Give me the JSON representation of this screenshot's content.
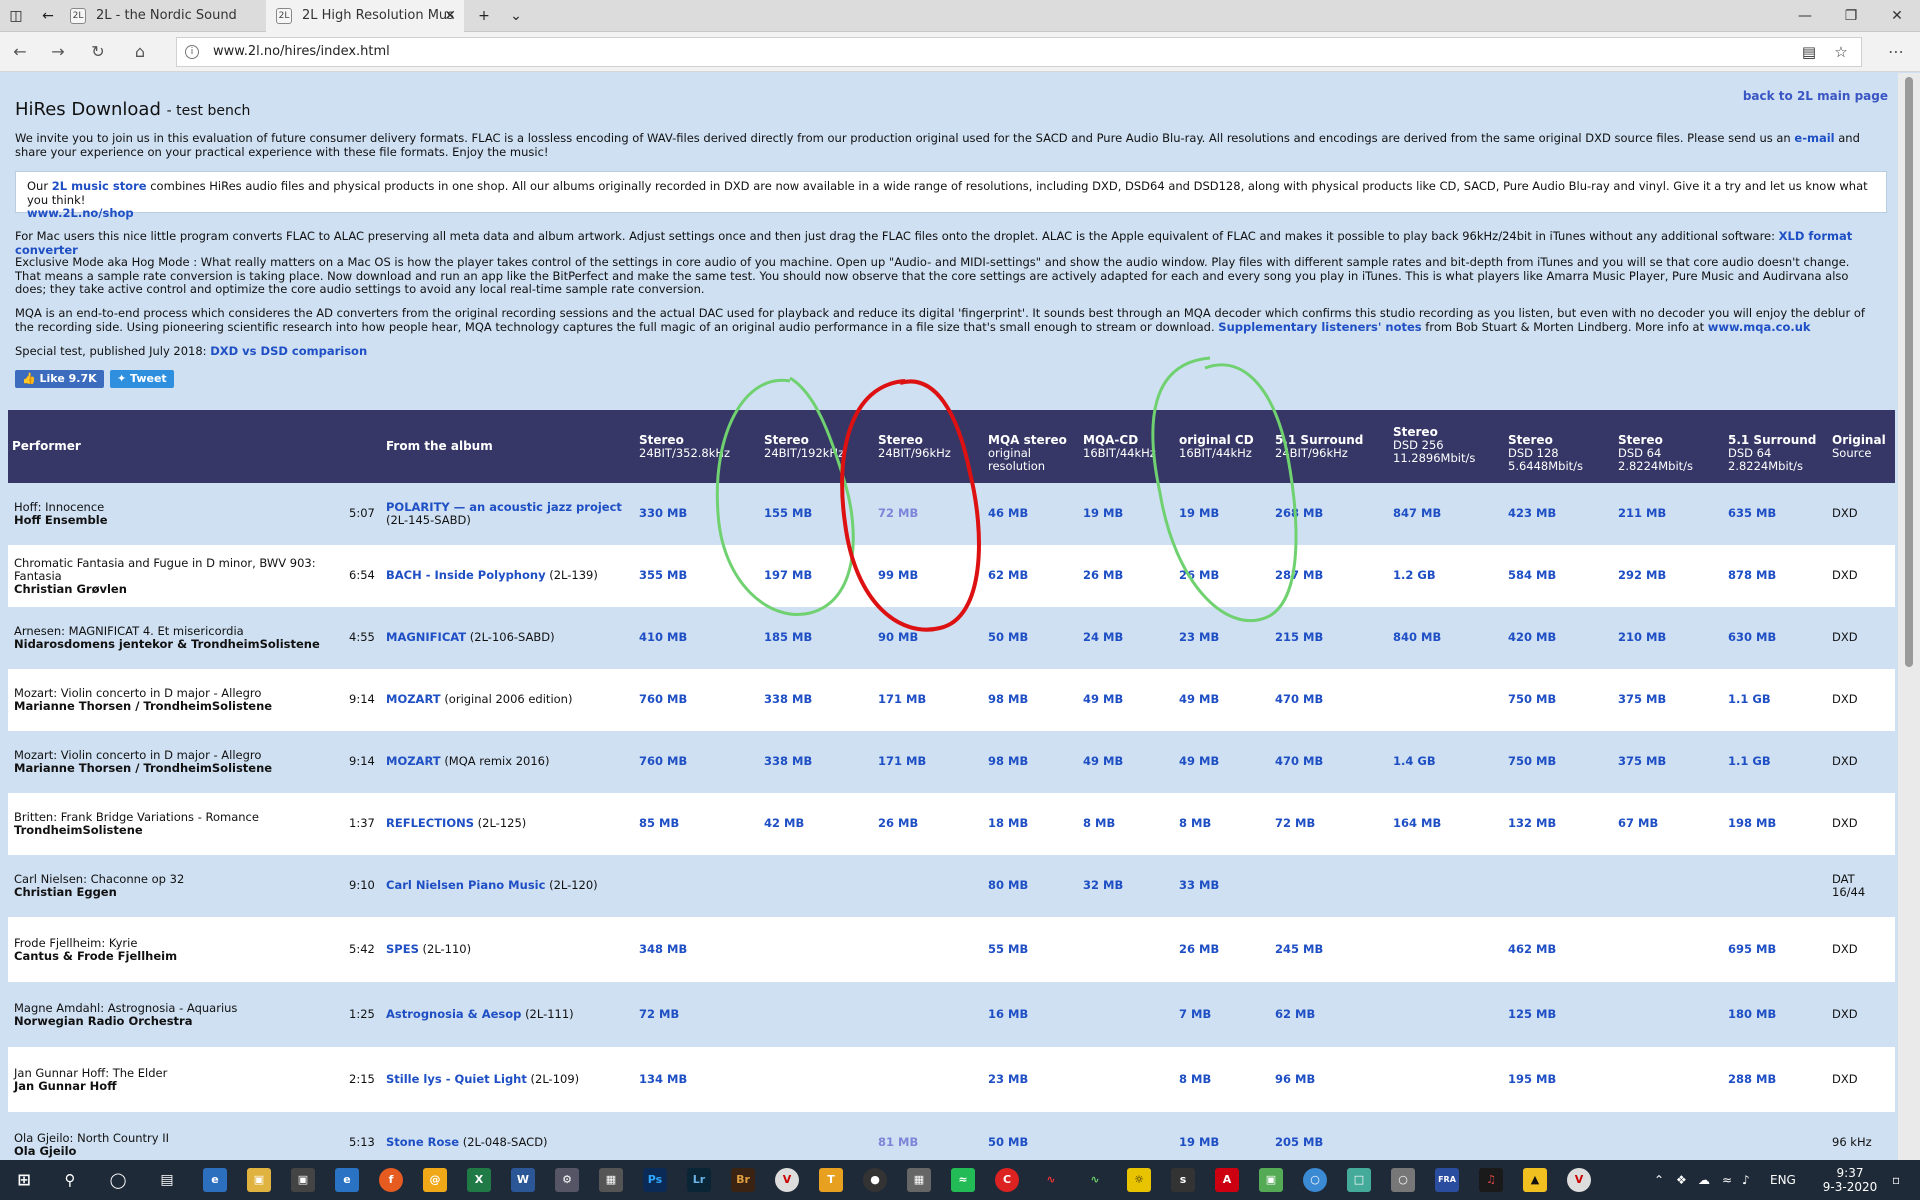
{
  "browser": {
    "tabs": [
      {
        "title": "2L - the Nordic Sound",
        "active": false
      },
      {
        "title": "2L High Resolution Mus",
        "active": true
      }
    ],
    "url": "www.2l.no/hires/index.html"
  },
  "page": {
    "top_link": "back to 2L main page",
    "title": "HiRes Download",
    "subtitle": "- test bench",
    "intro_1": "We invite you to join us in this evaluation of future consumer delivery formats. FLAC is a lossless encoding of WAV-files derived directly from our production original used for the SACD and Pure Audio Blu-ray. All resolutions and encodings are derived from the same original DXD source files. Please send us an",
    "intro_link": "e-mail",
    "intro_2": "and share your experience on your practical experience with these file formats. Enjoy the music!",
    "store_1": "Our",
    "store_link": "2L music store",
    "store_2": "combines HiRes audio files and physical products in one shop. All our albums originally recorded in DXD are now available in a wide range of resolutions, including DXD, DSD64 and DSD128, along with physical products like CD, SACD, Pure Audio Blu-ray and vinyl. Give it a try and let us know what you think!",
    "store_url": "www.2L.no/shop",
    "mac_1": "For Mac users this nice little program converts FLAC to ALAC preserving all meta data and album artwork. Adjust settings once and then just drag the FLAC files onto the droplet. ALAC is the Apple equivalent of FLAC and makes it possible to play back 96kHz/24bit in iTunes without any additional software:",
    "mac_link": "XLD format converter",
    "hog": "Exclusive Mode aka Hog Mode : What really matters on a Mac OS is how the player takes control of the settings in core audio of you machine. Open up \"Audio- and MIDI-settings\" and show the audio window. Play files with different sample rates and bit-depth from iTunes and you will se that core audio doesn't change. That means a sample rate conversion is taking place. Now download and run an app like the BitPerfect and make the same test. You should now observe that the core settings are actively adapted for each and every song you play in iTunes. This is what players like Amarra Music Player, Pure Music and Audirvana also does; they take active control and optimize the core audio settings to avoid any local real-time sample rate conversion.",
    "mqa_1": "MQA is an end-to-end process which consideres the AD converters from the original recording sessions and the actual DAC used for playback and reduce its digital 'fingerprint'. It sounds best through an MQA decoder which confirms this studio recording as you listen, but even with no decoder you will enjoy the deblur of the recording side. Using pioneering scientific research into how people hear, MQA technology captures the full magic of an original audio performance in a file size that's small enough to stream or download.",
    "mqa_link": "Supplementary listeners' notes",
    "mqa_2": "from Bob Stuart & Morten Lindberg. More info at",
    "mqa_link2": "www.mqa.co.uk",
    "special_1": "Special test, published July 2018:",
    "special_link": "DXD vs DSD comparison",
    "like_btn": "Like 9.7K",
    "tweet_btn": "Tweet"
  },
  "table": {
    "headers": [
      {
        "t": "Performer",
        "s": ""
      },
      {
        "t": "From the album",
        "s": ""
      },
      {
        "t": "Stereo",
        "s": "24BIT/352.8kHz"
      },
      {
        "t": "Stereo",
        "s": "24BIT/192kHz"
      },
      {
        "t": "Stereo",
        "s": "24BIT/96kHz"
      },
      {
        "t": "MQA stereo",
        "s": "original resolution"
      },
      {
        "t": "MQA-CD",
        "s": "16BIT/44kHz"
      },
      {
        "t": "original CD",
        "s": "16BIT/44kHz"
      },
      {
        "t": "5.1 Surround",
        "s": "24BIT/96kHz"
      },
      {
        "t": "Stereo",
        "s": "DSD 256 11.2896Mbit/s"
      },
      {
        "t": "Stereo",
        "s": "DSD 128 5.6448Mbit/s"
      },
      {
        "t": "Stereo",
        "s": "DSD 64 2.8224Mbit/s"
      },
      {
        "t": "5.1 Surround",
        "s": "DSD 64 2.8224Mbit/s"
      },
      {
        "t": "Original",
        "s": "Source"
      }
    ],
    "rows": [
      {
        "work": "Hoff: Innocence",
        "artist": "Hoff Ensemble",
        "time": "5:07",
        "album": "POLARITY — an acoustic jazz project",
        "code": "(2L-145-SABD)",
        "v": [
          "330 MB",
          "155 MB",
          "72 MB",
          "46 MB",
          "19 MB",
          "19 MB",
          "268 MB",
          "847 MB",
          "423 MB",
          "211 MB",
          "635 MB"
        ],
        "src": "DXD"
      },
      {
        "work": "Chromatic Fantasia and Fugue in D minor, BWV 903: Fantasia",
        "artist": "Christian Grøvlen",
        "time": "6:54",
        "album": "BACH - Inside Polyphony",
        "code": "(2L-139)",
        "v": [
          "355 MB",
          "197 MB",
          "99 MB",
          "62 MB",
          "26 MB",
          "26 MB",
          "287 MB",
          "1.2 GB",
          "584 MB",
          "292 MB",
          "878 MB"
        ],
        "src": "DXD"
      },
      {
        "work": "Arnesen: MAGNIFICAT 4. Et misericordia",
        "artist": "Nidarosdomens jentekor & TrondheimSolistene",
        "time": "4:55",
        "album": "MAGNIFICAT",
        "code": "(2L-106-SABD)",
        "v": [
          "410 MB",
          "185 MB",
          "90 MB",
          "50 MB",
          "24 MB",
          "23 MB",
          "215 MB",
          "840 MB",
          "420 MB",
          "210 MB",
          "630 MB"
        ],
        "src": "DXD"
      },
      {
        "work": "Mozart: Violin concerto in D major - Allegro",
        "artist": "Marianne Thorsen / TrondheimSolistene",
        "time": "9:14",
        "album": "MOZART",
        "code": "(original 2006 edition)",
        "v": [
          "760 MB",
          "338 MB",
          "171 MB",
          "98 MB",
          "49 MB",
          "49 MB",
          "470 MB",
          "",
          "750 MB",
          "375 MB",
          "1.1 GB"
        ],
        "src": "DXD"
      },
      {
        "work": "Mozart: Violin concerto in D major - Allegro",
        "artist": "Marianne Thorsen / TrondheimSolistene",
        "time": "9:14",
        "album": "MOZART",
        "code": "(MQA remix 2016)",
        "v": [
          "760 MB",
          "338 MB",
          "171 MB",
          "98 MB",
          "49 MB",
          "49 MB",
          "470 MB",
          "1.4 GB",
          "750 MB",
          "375 MB",
          "1.1 GB"
        ],
        "src": "DXD"
      },
      {
        "work": "Britten: Frank Bridge Variations - Romance",
        "artist": "TrondheimSolistene",
        "time": "1:37",
        "album": "REFLECTIONS",
        "code": "(2L-125)",
        "v": [
          "85 MB",
          "42 MB",
          "26 MB",
          "18 MB",
          "8 MB",
          "8 MB",
          "72 MB",
          "164 MB",
          "132 MB",
          "67 MB",
          "198 MB"
        ],
        "src": "DXD"
      },
      {
        "work": "Carl Nielsen: Chaconne op 32",
        "artist": "Christian Eggen",
        "time": "9:10",
        "album": "Carl Nielsen Piano Music",
        "code": "(2L-120)",
        "v": [
          "",
          "",
          "",
          "80 MB",
          "32 MB",
          "33 MB",
          "",
          "",
          "",
          "",
          ""
        ],
        "src": "DAT 16/44"
      },
      {
        "work": "Frode Fjellheim: Kyrie",
        "artist": "Cantus & Frode Fjellheim",
        "time": "5:42",
        "album": "SPES",
        "code": "(2L-110)",
        "v": [
          "348 MB",
          "",
          "",
          "55 MB",
          "",
          "26 MB",
          "245 MB",
          "",
          "462 MB",
          "",
          "695 MB"
        ],
        "src": "DXD"
      },
      {
        "work": "Magne Amdahl: Astrognosia - Aquarius",
        "artist": "Norwegian Radio Orchestra",
        "time": "1:25",
        "album": "Astrognosia & Aesop",
        "code": "(2L-111)",
        "v": [
          "72 MB",
          "",
          "",
          "16 MB",
          "",
          "7 MB",
          "62 MB",
          "",
          "125 MB",
          "",
          "180 MB"
        ],
        "src": "DXD"
      },
      {
        "work": "Jan Gunnar Hoff: The Elder",
        "artist": "Jan Gunnar Hoff",
        "time": "2:15",
        "album": "Stille lys - Quiet Light",
        "code": "(2L-109)",
        "v": [
          "134 MB",
          "",
          "",
          "23 MB",
          "",
          "8 MB",
          "96 MB",
          "",
          "195 MB",
          "",
          "288 MB"
        ],
        "src": "DXD"
      },
      {
        "work": "Ola Gjeilo: North Country II",
        "artist": "Ola Gjeilo",
        "time": "5:13",
        "album": "Stone Rose",
        "code": "(2L-048-SACD)",
        "v": [
          "",
          "",
          "81 MB",
          "50 MB",
          "",
          "19 MB",
          "205 MB",
          "",
          "",
          "",
          ""
        ],
        "src": "96 kHz"
      }
    ]
  },
  "taskbar": {
    "apps": [
      "Ps",
      "Lr",
      "Br",
      "Acrobat"
    ],
    "lang": "ENG",
    "time": "9:37",
    "date": "9-3-2020"
  }
}
